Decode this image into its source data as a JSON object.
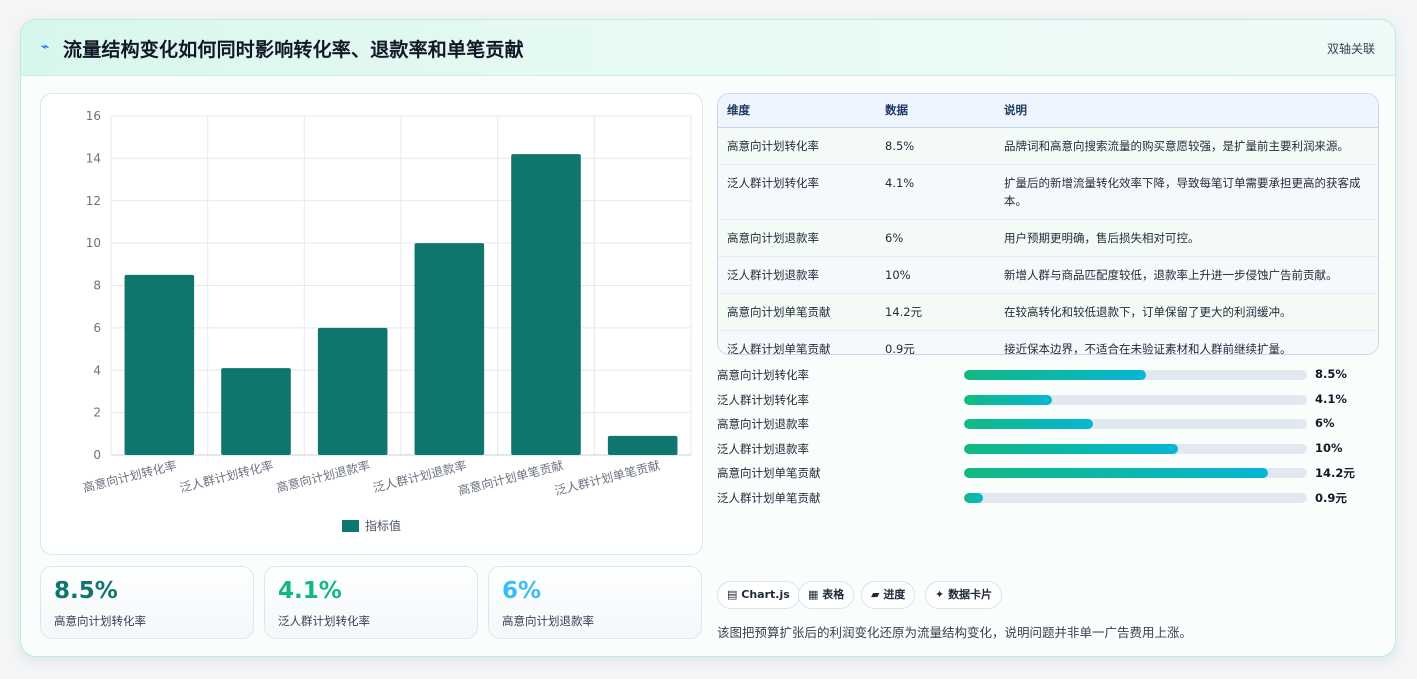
{
  "header": {
    "icon": "lightning-icon",
    "title": "流量结构变化如何同时影响转化率、退款率和单笔贡献",
    "badge": "双轴关联"
  },
  "chart_data": {
    "type": "bar",
    "categories": [
      "高意向计划转化率",
      "泛人群计划转化率",
      "高意向计划退款率",
      "泛人群计划退款率",
      "高意向计划单笔贡献",
      "泛人群计划单笔贡献"
    ],
    "series": [
      {
        "name": "指标值",
        "values": [
          8.5,
          4.1,
          6,
          10,
          14.2,
          0.9
        ]
      }
    ],
    "yticks": [
      "0",
      "2",
      "4",
      "6",
      "8",
      "10",
      "12",
      "14",
      "16"
    ],
    "ylim": [
      0,
      16
    ],
    "grid": true,
    "legend": "bottom",
    "bar_color": "#0f766e"
  },
  "kpis": [
    {
      "value": "8.5%",
      "label": "高意向计划转化率",
      "color": "#0f766e"
    },
    {
      "value": "4.1%",
      "label": "泛人群计划转化率",
      "color": "#10b981"
    },
    {
      "value": "6%",
      "label": "高意向计划退款率",
      "color": "#38bdf8"
    }
  ],
  "table": {
    "headers": [
      "维度",
      "数据",
      "说明"
    ],
    "rows": [
      [
        "高意向计划转化率",
        "8.5%",
        "品牌词和高意向搜索流量的购买意愿较强，是扩量前主要利润来源。"
      ],
      [
        "泛人群计划转化率",
        "4.1%",
        "扩量后的新增流量转化效率下降，导致每笔订单需要承担更高的获客成本。"
      ],
      [
        "高意向计划退款率",
        "6%",
        "用户预期更明确，售后损失相对可控。"
      ],
      [
        "泛人群计划退款率",
        "10%",
        "新增人群与商品匹配度较低，退款率上升进一步侵蚀广告前贡献。"
      ],
      [
        "高意向计划单笔贡献",
        "14.2元",
        "在较高转化和较低退款下，订单保留了更大的利润缓冲。"
      ],
      [
        "泛人群计划单笔贡献",
        "0.9元",
        "接近保本边界，不适合在未验证素材和人群前继续扩量。"
      ]
    ]
  },
  "progress": {
    "max": 16,
    "items": [
      {
        "label": "高意向计划转化率",
        "value": 8.5,
        "display": "8.5%"
      },
      {
        "label": "泛人群计划转化率",
        "value": 4.1,
        "display": "4.1%"
      },
      {
        "label": "高意向计划退款率",
        "value": 6,
        "display": "6%"
      },
      {
        "label": "泛人群计划退款率",
        "value": 10,
        "display": "10%"
      },
      {
        "label": "高意向计划单笔贡献",
        "value": 14.2,
        "display": "14.2元"
      },
      {
        "label": "泛人群计划单笔贡献",
        "value": 0.9,
        "display": "0.9元"
      }
    ]
  },
  "tags": [
    {
      "icon": "chart-icon",
      "glyph": "▤",
      "label": "Chart.js"
    },
    {
      "icon": "table-icon",
      "glyph": "▦",
      "label": "表格"
    },
    {
      "icon": "progress-icon",
      "glyph": "▰",
      "label": "进度"
    },
    {
      "icon": "sparkle-icon",
      "glyph": "✦",
      "label": "数据卡片"
    }
  ],
  "footnote": "该图把预算扩张后的利润变化还原为流量结构变化，说明问题并非单一广告费用上涨。"
}
